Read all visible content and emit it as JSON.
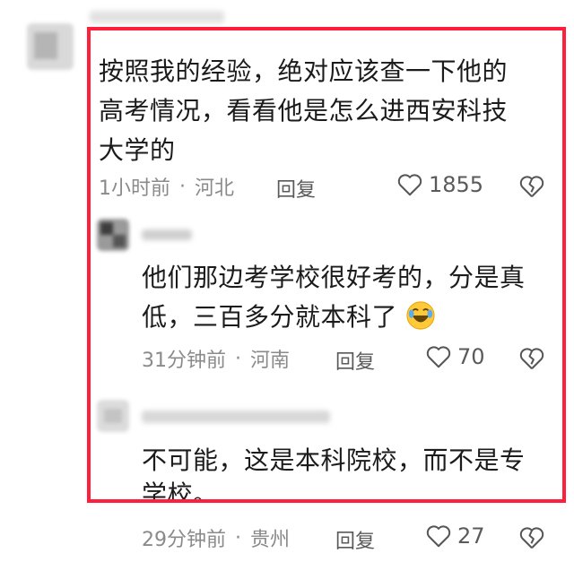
{
  "highlight_color": "#ff1e3c",
  "comments": [
    {
      "text_lines": [
        "按照我的经验，绝对应该查一下他的",
        "高考情况，看看他是怎么进西安科技",
        "大学的"
      ],
      "time": "1小时前",
      "location": "河北",
      "reply_label": "回复",
      "likes": "1855"
    },
    {
      "text_lines": [
        "他们那边考学校很好考的，分是真",
        "低，三百多分就本科了"
      ],
      "emoji": "rofl-emoji",
      "time": "31分钟前",
      "location": "河南",
      "reply_label": "回复",
      "likes": "70"
    },
    {
      "text_lines": [
        "不可能，这是本科院校，而不是专",
        "学校。"
      ],
      "time": "29分钟前",
      "location": "贵州",
      "reply_label": "回复",
      "likes": "27"
    }
  ],
  "meta_separator": "·",
  "icons": {
    "like": "heart-outline-icon",
    "dislike": "broken-heart-icon"
  }
}
